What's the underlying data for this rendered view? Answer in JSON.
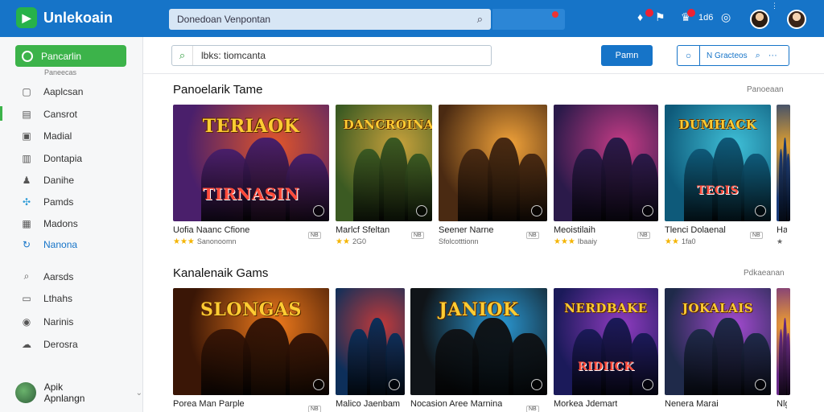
{
  "app": {
    "title": "Unlekoain"
  },
  "topbar": {
    "search_placeholder": "Donedoan Venpontan",
    "notif_count": "1d6"
  },
  "sidebar": {
    "primary_label": "Pancarlin",
    "sub_label": "Paneecas",
    "items": [
      {
        "label": "Aaplcsan",
        "icon": "apps-icon"
      },
      {
        "label": "Cansrot",
        "icon": "grid-icon"
      },
      {
        "label": "Madial",
        "icon": "media-icon"
      },
      {
        "label": "Dontapia",
        "icon": "bookmark-icon"
      },
      {
        "label": "Danihe",
        "icon": "user-icon"
      },
      {
        "label": "Pamds",
        "icon": "puzzle-icon"
      },
      {
        "label": "Madons",
        "icon": "list-icon"
      },
      {
        "label": "Nanona",
        "icon": "sync-icon"
      },
      {
        "label": "Aarsds",
        "icon": "search-icon"
      },
      {
        "label": "Lthahs",
        "icon": "chat-icon"
      },
      {
        "label": "Narinis",
        "icon": "shield-icon"
      },
      {
        "label": "Derosra",
        "icon": "cloud-icon"
      }
    ],
    "user_name": "Apik Apnlangn"
  },
  "toolbar": {
    "search_value": "lbks: tiomcanta",
    "action_label": "Pamn",
    "filter_label": "N Gracteos"
  },
  "sections": [
    {
      "title": "Panoelarik Tame",
      "link": "Panoeaan",
      "cards": [
        {
          "banner": "TERIAOK",
          "subbanner": "TIRNASIN",
          "name": "Uofia Naanc Cfione",
          "meta": "Sanonoomn",
          "stars": "★★★",
          "pill": "NB",
          "color1": "#4a1f6b",
          "color2": "#e2562a"
        },
        {
          "banner": "DANCROINA",
          "subbanner": "",
          "name": "Marlcf Sfeltan",
          "meta": "2G0",
          "stars": "★★",
          "pill": "NB",
          "color1": "#3b5a22",
          "color2": "#c9a23c"
        },
        {
          "banner": "",
          "subbanner": "",
          "name": "Seener Narne",
          "meta": "Sfolcotttionn",
          "stars": "",
          "pill": "NB",
          "color1": "#4a2a12",
          "color2": "#f2a33a"
        },
        {
          "banner": "",
          "subbanner": "",
          "name": "Meoistilaih",
          "meta": "Ibaaiy",
          "stars": "★★★",
          "pill": "NB",
          "color1": "#2b1a4a",
          "color2": "#c63c86"
        },
        {
          "banner": "DUMHACK",
          "subbanner": "TEGIS",
          "name": "Tlenci Dolaenal",
          "meta": "1fa0",
          "stars": "★★",
          "pill": "NB",
          "color1": "#0e5a7a",
          "color2": "#3fc0d8"
        },
        {
          "banner": "",
          "subbanner": "",
          "name": "Ha",
          "meta": "★",
          "stars": "",
          "pill": "",
          "color1": "#1a3c7a",
          "color2": "#e0a030"
        }
      ]
    },
    {
      "title": "Kanalenaik Gams",
      "link": "Pdkaeanan",
      "cards": [
        {
          "banner": "SLONGAS",
          "subbanner": "",
          "name": "Porea Man Parple",
          "meta": "",
          "stars": "",
          "pill": "NB",
          "color1": "#3a1606",
          "color2": "#f07b1c"
        },
        {
          "banner": "",
          "subbanner": "",
          "name": "Malico Jaenbam",
          "meta": "",
          "stars": "",
          "pill": "",
          "color1": "#0d2f5a",
          "color2": "#c23a3a"
        },
        {
          "banner": "JANIOK",
          "subbanner": "",
          "name": "Nocasion Aree Marnina",
          "meta": "",
          "stars": "",
          "pill": "NB",
          "color1": "#101418",
          "color2": "#2b9ad6"
        },
        {
          "banner": "NERDBAKE",
          "subbanner": "RIDIICK",
          "name": "Morkea Jdemart",
          "meta": "",
          "stars": "",
          "pill": "",
          "color1": "#1b1a5a",
          "color2": "#8f3cc0"
        },
        {
          "banner": "JOKALAIS",
          "subbanner": "",
          "name": "Nenera Marai",
          "meta": "",
          "stars": "",
          "pill": "",
          "color1": "#1f2a4a",
          "color2": "#a34ad0"
        },
        {
          "banner": "",
          "subbanner": "",
          "name": "Nlg",
          "meta": "",
          "stars": "",
          "pill": "",
          "color1": "#6a2a8a",
          "color2": "#f0a030"
        }
      ]
    }
  ],
  "colors": {
    "topbar": "#1674c8",
    "accent_green": "#3cb34a",
    "star": "#f4b400"
  }
}
